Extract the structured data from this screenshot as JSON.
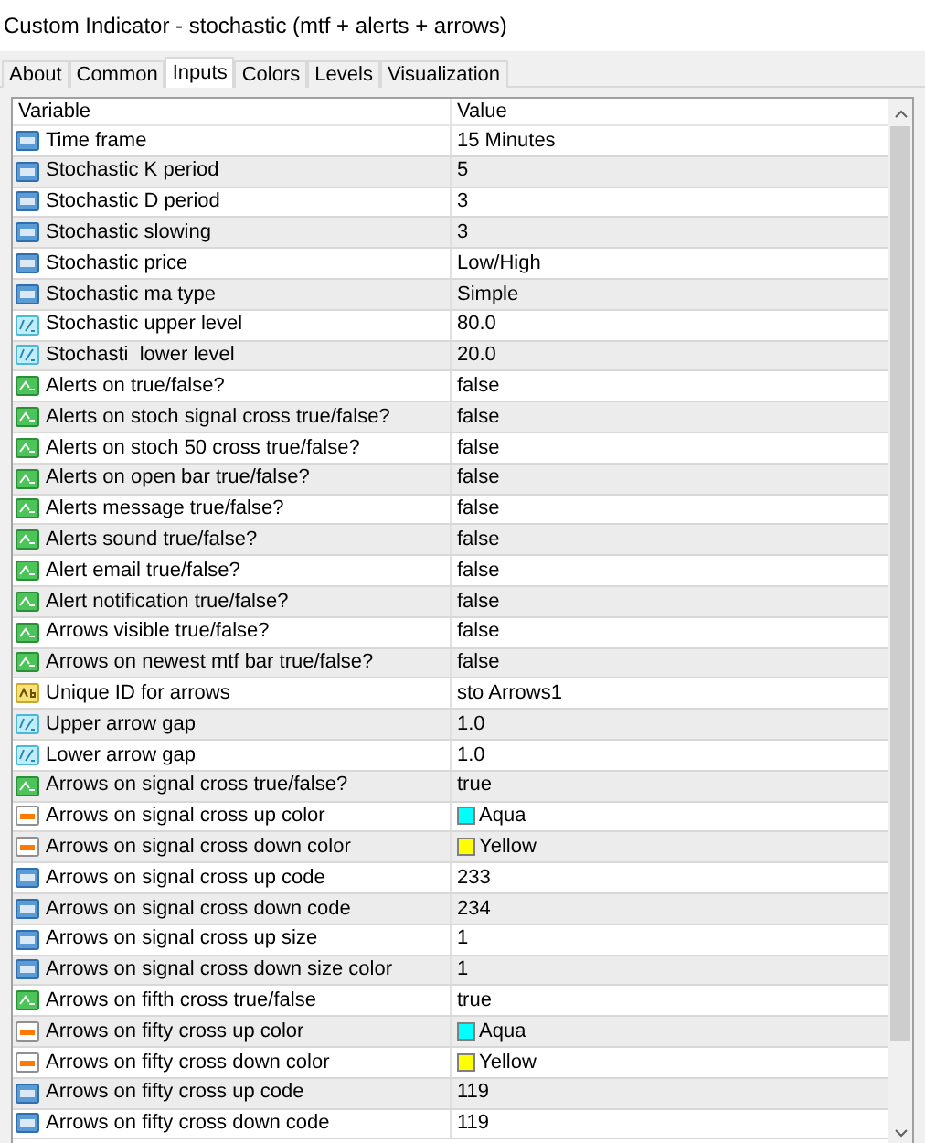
{
  "window": {
    "title": "Custom Indicator - stochastic (mtf + alerts + arrows)"
  },
  "tabs": [
    {
      "label": "About",
      "selected": false
    },
    {
      "label": "Common",
      "selected": false
    },
    {
      "label": "Inputs",
      "selected": true
    },
    {
      "label": "Colors",
      "selected": false
    },
    {
      "label": "Levels",
      "selected": false
    },
    {
      "label": "Visualization",
      "selected": false
    }
  ],
  "table": {
    "columns": [
      "Variable",
      "Value"
    ],
    "rows": [
      {
        "kind": "int",
        "variable": "Time frame",
        "value": "15 Minutes"
      },
      {
        "kind": "int",
        "variable": "Stochastic K period",
        "value": "5"
      },
      {
        "kind": "int",
        "variable": "Stochastic D period",
        "value": "3"
      },
      {
        "kind": "int",
        "variable": "Stochastic slowing",
        "value": "3"
      },
      {
        "kind": "int",
        "variable": "Stochastic price",
        "value": "Low/High"
      },
      {
        "kind": "int",
        "variable": "Stochastic ma type",
        "value": "Simple"
      },
      {
        "kind": "double",
        "variable": "Stochastic upper level",
        "value": "80.0"
      },
      {
        "kind": "double",
        "variable": "Stochasti  lower level",
        "value": "20.0"
      },
      {
        "kind": "bool",
        "variable": "Alerts on true/false?",
        "value": "false"
      },
      {
        "kind": "bool",
        "variable": "Alerts on stoch signal cross true/false?",
        "value": "false"
      },
      {
        "kind": "bool",
        "variable": "Alerts on stoch 50 cross true/false?",
        "value": "false"
      },
      {
        "kind": "bool",
        "variable": "Alerts on open bar true/false?",
        "value": "false"
      },
      {
        "kind": "bool",
        "variable": "Alerts message true/false?",
        "value": "false"
      },
      {
        "kind": "bool",
        "variable": "Alerts sound true/false?",
        "value": "false"
      },
      {
        "kind": "bool",
        "variable": "Alert email true/false?",
        "value": "false"
      },
      {
        "kind": "bool",
        "variable": "Alert notification true/false?",
        "value": "false"
      },
      {
        "kind": "bool",
        "variable": "Arrows visible true/false?",
        "value": "false"
      },
      {
        "kind": "bool",
        "variable": "Arrows on newest mtf bar true/false?",
        "value": "false"
      },
      {
        "kind": "string",
        "variable": "Unique ID for arrows",
        "value": "sto Arrows1"
      },
      {
        "kind": "double",
        "variable": "Upper arrow gap",
        "value": "1.0"
      },
      {
        "kind": "double",
        "variable": "Lower arrow gap",
        "value": "1.0"
      },
      {
        "kind": "bool",
        "variable": "Arrows on signal cross true/false?",
        "value": "true"
      },
      {
        "kind": "color",
        "variable": "Arrows on signal cross up color",
        "value": "Aqua",
        "color": "#00ffff"
      },
      {
        "kind": "color",
        "variable": "Arrows on signal cross down color",
        "value": "Yellow",
        "color": "#ffff00"
      },
      {
        "kind": "int",
        "variable": "Arrows on signal cross up code",
        "value": "233"
      },
      {
        "kind": "int",
        "variable": "Arrows on signal cross down code",
        "value": "234"
      },
      {
        "kind": "int",
        "variable": "Arrows on signal cross up size",
        "value": "1"
      },
      {
        "kind": "int",
        "variable": "Arrows on signal cross down size color",
        "value": "1"
      },
      {
        "kind": "bool",
        "variable": "Arrows on fifth cross true/false",
        "value": "true"
      },
      {
        "kind": "color",
        "variable": "Arrows on fifty cross up color",
        "value": "Aqua",
        "color": "#00ffff"
      },
      {
        "kind": "color",
        "variable": "Arrows on fifty cross down color",
        "value": "Yellow",
        "color": "#ffff00"
      },
      {
        "kind": "int",
        "variable": "Arrows on fifty cross up code",
        "value": "119"
      },
      {
        "kind": "int",
        "variable": "Arrows on fifty cross down code",
        "value": "119"
      }
    ]
  }
}
